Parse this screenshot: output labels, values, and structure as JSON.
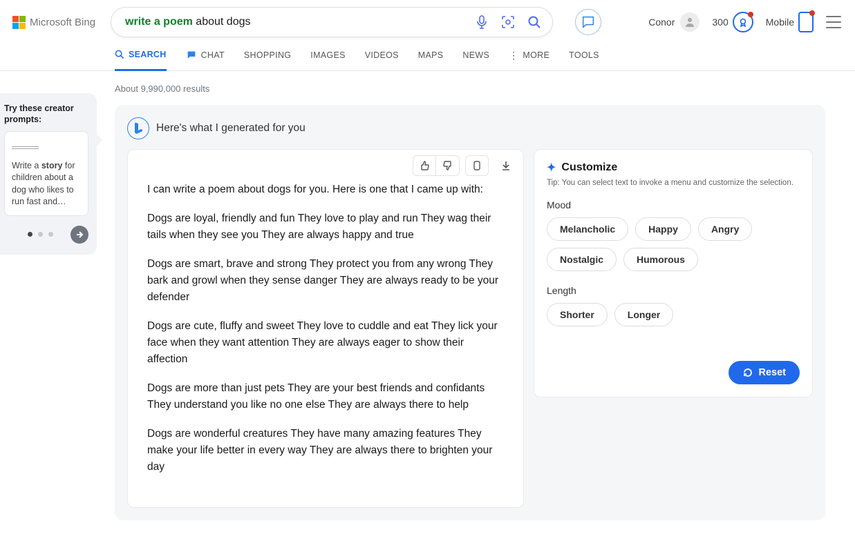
{
  "brand": "Microsoft Bing",
  "search": {
    "query_highlight": "write a poem",
    "query_rest": " about dogs",
    "full_query": "write a poem about dogs"
  },
  "user": {
    "name": "Conor",
    "points": "300",
    "mobile_label": "Mobile"
  },
  "nav": {
    "search": "SEARCH",
    "chat": "CHAT",
    "shopping": "SHOPPING",
    "images": "IMAGES",
    "videos": "VIDEOS",
    "maps": "MAPS",
    "news": "NEWS",
    "more": "MORE",
    "tools": "TOOLS"
  },
  "sidebar": {
    "title": "Try these creator prompts:",
    "card": {
      "prefix": "Write a ",
      "bold": "story",
      "suffix": " for children about a dog who likes to run fast and…"
    }
  },
  "results_count": "About 9,990,000 results",
  "gen_header": "Here's what I generated for you",
  "answer": {
    "intro": "I can write a poem about dogs for you. Here is one that I came up with:",
    "p1": "Dogs are loyal, friendly and fun They love to play and run They wag their tails when they see you They are always happy and true",
    "p2": "Dogs are smart, brave and strong They protect you from any wrong They bark and growl when they sense danger They are always ready to be your defender",
    "p3": "Dogs are cute, fluffy and sweet They love to cuddle and eat They lick your face when they want attention They are always eager to show their affection",
    "p4": "Dogs are more than just pets They are your best friends and confidants They understand you like no one else They are always there to help",
    "p5": "Dogs are wonderful creatures They have many amazing features They make your life better in every way They are always there to brighten your day"
  },
  "customize": {
    "title": "Customize",
    "tip": "Tip: You can select text to invoke a menu and customize the selection.",
    "mood_label": "Mood",
    "moods": {
      "m0": "Melancholic",
      "m1": "Happy",
      "m2": "Angry",
      "m3": "Nostalgic",
      "m4": "Humorous"
    },
    "length_label": "Length",
    "lengths": {
      "l0": "Shorter",
      "l1": "Longer"
    },
    "reset": "Reset"
  }
}
